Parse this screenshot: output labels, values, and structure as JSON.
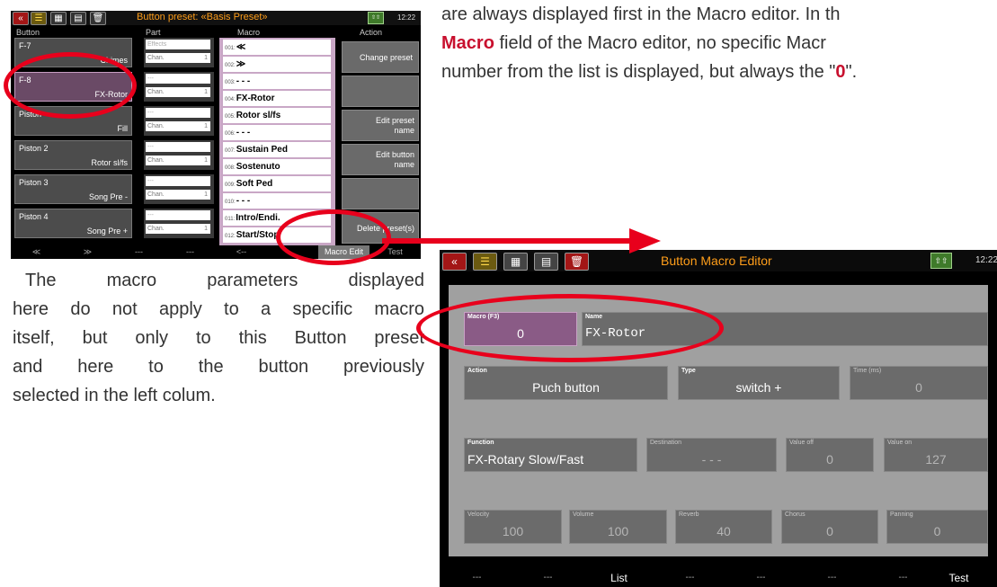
{
  "doc_text": {
    "top_line1": "are always displayed first in the Macro editor. In th",
    "top_line2_bold": "Macro",
    "top_line2_rest": " field of the Macro editor, no specific Macr",
    "top_line3_pre": "number from the list is displayed, but always the \"",
    "top_line3_bold": "0",
    "top_line3_post": "\".",
    "body_lines": [
      "The macro parameters displayed",
      "here do not apply to a specific macro",
      "itself, but only to this Button preset",
      "and here to the button previously",
      "selected in the left colum."
    ]
  },
  "screen1": {
    "title": "Button preset: «Basis Preset»",
    "clock": "12:22",
    "shift_label": "SHIFT",
    "columns": [
      "Button",
      "Part",
      "Macro",
      "Action"
    ],
    "buttons": [
      {
        "name": "F-7",
        "value": "Chimes"
      },
      {
        "name": "F-8",
        "value": "FX-Rotor",
        "selected": true
      },
      {
        "name": "Piston",
        "value": "Fill"
      },
      {
        "name": "Piston 2",
        "value": "Rotor sl/fs"
      },
      {
        "name": "Piston 3",
        "value": "Song Pre -"
      },
      {
        "name": "Piston 4",
        "value": "Song Pre +"
      }
    ],
    "parts": [
      {
        "top": "Effects",
        "bottom": "Chan.",
        "num": "1"
      },
      {
        "top": "---",
        "bottom": "Chan.",
        "num": "1"
      },
      {
        "top": "---",
        "bottom": "Chan.",
        "num": "1"
      },
      {
        "top": "---",
        "bottom": "Chan.",
        "num": "1"
      },
      {
        "top": "---",
        "bottom": "Chan.",
        "num": "1"
      },
      {
        "top": "---",
        "bottom": "Chan.",
        "num": "1"
      }
    ],
    "macros": [
      {
        "num": "001:",
        "label": "≪"
      },
      {
        "num": "002:",
        "label": "≫"
      },
      {
        "num": "003:",
        "label": "- - -"
      },
      {
        "num": "004:",
        "label": "FX-Rotor"
      },
      {
        "num": "005:",
        "label": "Rotor sl/fs"
      },
      {
        "num": "006:",
        "label": "- - -"
      },
      {
        "num": "007:",
        "label": "Sustain Ped"
      },
      {
        "num": "008:",
        "label": "Sostenuto"
      },
      {
        "num": "009:",
        "label": "Soft Ped"
      },
      {
        "num": "010:",
        "label": "- - -"
      },
      {
        "num": "011:",
        "label": "Intro/Endi."
      },
      {
        "num": "012:",
        "label": "Start/Stop"
      }
    ],
    "actions": [
      "Change preset",
      "",
      "Edit preset name",
      "Edit button name",
      "",
      "Delete preset(s)"
    ],
    "bottom_bar": [
      "≪",
      "≫",
      "---",
      "---",
      "<--",
      "",
      "Macro Edit",
      "Test"
    ]
  },
  "screen2": {
    "title": "Button Macro Editor",
    "clock": "12:22",
    "shift_label": "SHIFT",
    "fields": {
      "macro": {
        "label": "Macro (F3)",
        "value": "0"
      },
      "name": {
        "label": "Name",
        "value": "FX-Rotor"
      },
      "action": {
        "label": "Action",
        "value": "Puch button"
      },
      "type": {
        "label": "Type",
        "value": "switch +"
      },
      "time": {
        "label": "Time (ms)",
        "value": "0"
      },
      "function": {
        "label": "Function",
        "value": "FX-Rotary Slow/Fast"
      },
      "destination": {
        "label": "Destination",
        "value": "- - -"
      },
      "value_off": {
        "label": "Value off",
        "value": "0"
      },
      "value_on": {
        "label": "Value on",
        "value": "127"
      },
      "velocity": {
        "label": "Velocity",
        "value": "100"
      },
      "volume": {
        "label": "Volume",
        "value": "100"
      },
      "reverb": {
        "label": "Reverb",
        "value": "40"
      },
      "chorus": {
        "label": "Chorus",
        "value": "0"
      },
      "panning": {
        "label": "Panning",
        "value": "0"
      }
    },
    "bottom_bar": [
      "---",
      "---",
      "List",
      "---",
      "---",
      "---",
      "---",
      "Test"
    ]
  },
  "colors": {
    "highlight": "#e8001c",
    "title_orange": "#ff9e1a",
    "selected_purple": "#8a5b86"
  }
}
